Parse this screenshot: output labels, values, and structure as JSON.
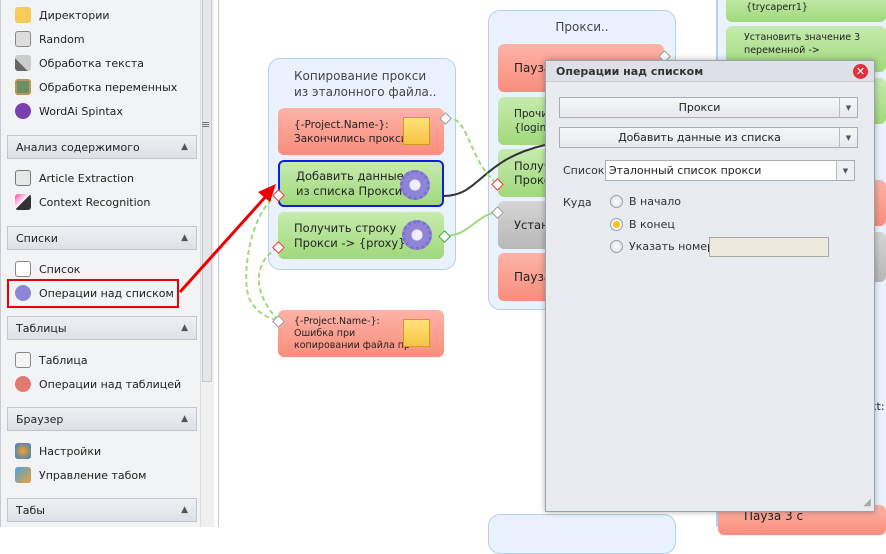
{
  "sidebar": {
    "items_top": [
      {
        "label": "Директории",
        "icon": "folder-icon"
      },
      {
        "label": "Random",
        "icon": "dice-icon"
      },
      {
        "label": "Обработка текста",
        "icon": "pen-icon"
      },
      {
        "label": "Обработка переменных",
        "icon": "chalkboard-icon"
      },
      {
        "label": "WordAi Spintax",
        "icon": "wordai-icon"
      }
    ],
    "sections": [
      {
        "title": "Анализ содержимого",
        "items": [
          {
            "label": "Article Extraction"
          },
          {
            "label": "Context Recognition"
          }
        ]
      },
      {
        "title": "Списки",
        "items": [
          {
            "label": "Список"
          },
          {
            "label": "Операции над списком"
          }
        ]
      },
      {
        "title": "Таблицы",
        "items": [
          {
            "label": "Таблица"
          },
          {
            "label": "Операции над таблицей"
          }
        ]
      },
      {
        "title": "Браузер",
        "items": [
          {
            "label": "Настройки"
          },
          {
            "label": "Управление табом"
          }
        ]
      },
      {
        "title": "Табы",
        "items": []
      }
    ]
  },
  "canvas": {
    "group1": {
      "title": "Копирование прокси из эталонного файла..",
      "nodes": [
        {
          "line1": "{-Project.Name-}:",
          "line2": "Закончились прокси.."
        },
        {
          "line1": "Добавить данные",
          "line2": "из списка Прокси"
        },
        {
          "line1": "Получить строку",
          "line2": "Прокси -> {proxy}"
        }
      ]
    },
    "error_node": {
      "line1": "{-Project.Name-}:",
      "line2": "Ошибка при",
      "line3": "копировании  файла пр"
    },
    "group2": {
      "title": "Прокси..",
      "nodes": [
        "Пауза",
        "Прочит\n{loginp",
        "Получ\nПрокс",
        "Устан",
        "Пауза"
      ]
    },
    "right": {
      "n1": "{trycaperr1}",
      "n2a": "Установить значение 3",
      "n2b": "переменной ->",
      "bottom": "Пауза 3 с",
      "partial": "xt:"
    }
  },
  "dialog": {
    "title": "Операции над списком",
    "combo1": "Прокси",
    "combo2": "Добавить данные из списка",
    "list_label": "Список",
    "list_value": "Эталонный список прокси",
    "where_label": "Куда",
    "options": [
      {
        "label": "В начало",
        "selected": false
      },
      {
        "label": "В конец",
        "selected": true
      },
      {
        "label": "Указать номер",
        "selected": false
      }
    ],
    "number_value": ""
  }
}
